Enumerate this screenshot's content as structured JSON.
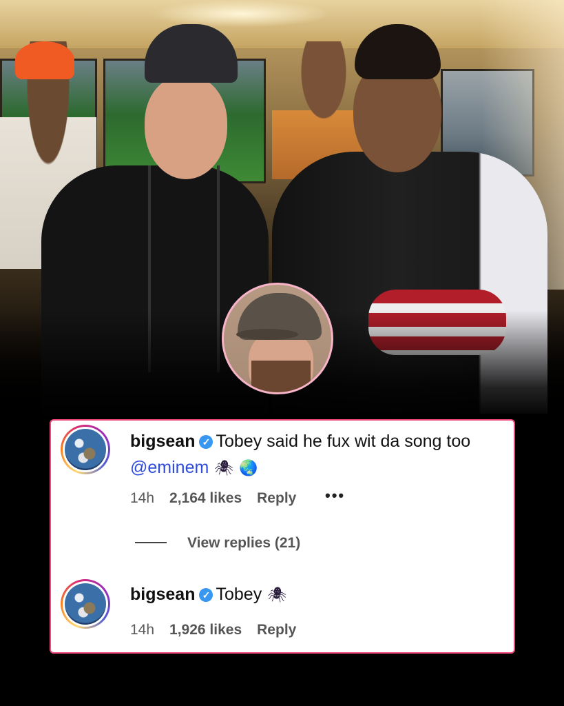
{
  "comments": [
    {
      "username": "bigsean",
      "verified_icon": "verified-badge-icon",
      "text": "Tobey said he fux wit da song too",
      "mention": "@eminem",
      "emojis": [
        "🕷",
        "🌏"
      ],
      "time": "14h",
      "likes": "2,164 likes",
      "reply": "Reply",
      "more": "•••"
    },
    {
      "username": "bigsean",
      "verified_icon": "verified-badge-icon",
      "text": "Tobey",
      "emojis": [
        "🕷"
      ],
      "time": "14h",
      "likes": "1,926 likes",
      "reply": "Reply"
    }
  ],
  "view_replies": "View replies (21)",
  "colors": {
    "card_border": "#f04a7c",
    "mention": "#2e4bdb",
    "verified": "#3897f0",
    "avatar_ring": [
      "#feda75",
      "#fa7e1e",
      "#d62976",
      "#962fbf",
      "#4f5bd5"
    ]
  }
}
